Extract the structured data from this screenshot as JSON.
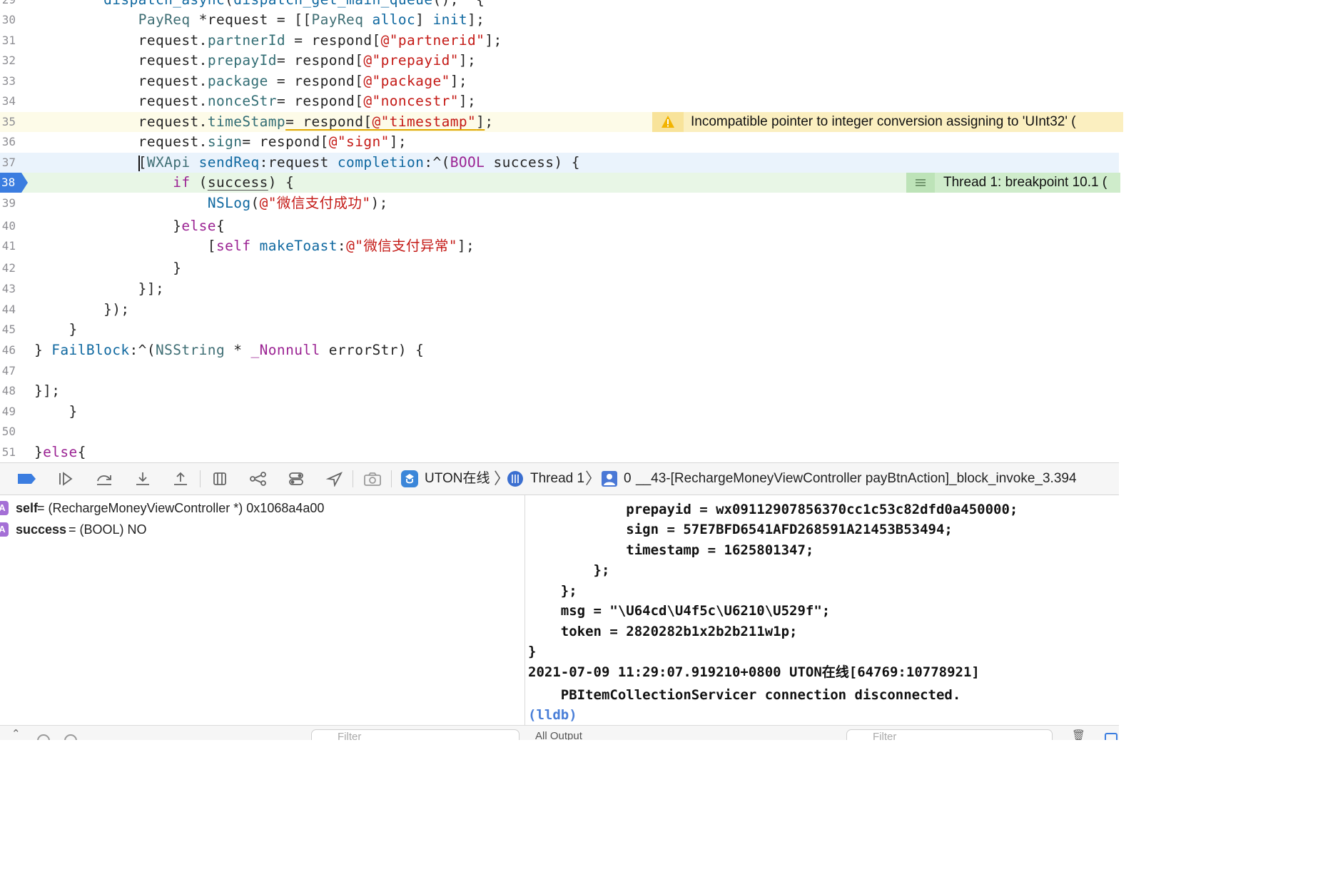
{
  "editor": {
    "lines": [
      {
        "num": "29",
        "html_tokens": [
          [
            "plain",
            "        "
          ],
          [
            "fn",
            "dispatch_async"
          ],
          [
            "plain",
            "("
          ],
          [
            "fn",
            "dispatch_get_main_queue"
          ],
          [
            "plain",
            "(), ^{"
          ]
        ]
      },
      {
        "num": "30",
        "tokens": [
          [
            "plain",
            "            "
          ],
          [
            "ty",
            "PayReq"
          ],
          [
            "plain",
            " *request = [["
          ],
          [
            "ty",
            "PayReq"
          ],
          [
            "plain",
            " "
          ],
          [
            "fn",
            "alloc"
          ],
          [
            "plain",
            "] "
          ],
          [
            "fn",
            "init"
          ],
          [
            "plain",
            "];"
          ]
        ]
      },
      {
        "num": "31",
        "tokens": [
          [
            "plain",
            "            request."
          ],
          [
            "prop",
            "partnerId"
          ],
          [
            "plain",
            " = respond["
          ],
          [
            "str",
            "@\"partnerid\""
          ],
          [
            "plain",
            "];"
          ]
        ]
      },
      {
        "num": "32",
        "tokens": [
          [
            "plain",
            "            request."
          ],
          [
            "prop",
            "prepayId"
          ],
          [
            "plain",
            "= respond["
          ],
          [
            "str",
            "@\"prepayid\""
          ],
          [
            "plain",
            "];"
          ]
        ]
      },
      {
        "num": "33",
        "tokens": [
          [
            "plain",
            "            request."
          ],
          [
            "prop",
            "package"
          ],
          [
            "plain",
            " = respond["
          ],
          [
            "str",
            "@\"package\""
          ],
          [
            "plain",
            "];"
          ]
        ]
      },
      {
        "num": "34",
        "tokens": [
          [
            "plain",
            "            request."
          ],
          [
            "prop",
            "nonceStr"
          ],
          [
            "plain",
            "= respond["
          ],
          [
            "str",
            "@\"noncestr\""
          ],
          [
            "plain",
            "];"
          ]
        ]
      },
      {
        "num": "35",
        "tokens": [
          [
            "plain",
            "            request."
          ],
          [
            "prop",
            "timeStamp"
          ],
          [
            "uline",
            "= respond["
          ],
          [
            "ustr",
            "@\"timestamp\""
          ],
          [
            "uline",
            "]"
          ],
          [
            "plain",
            ";"
          ]
        ]
      },
      {
        "num": "36",
        "tokens": [
          [
            "plain",
            "            request."
          ],
          [
            "prop",
            "sign"
          ],
          [
            "plain",
            "= respond["
          ],
          [
            "str",
            "@\"sign\""
          ],
          [
            "plain",
            "];"
          ]
        ]
      },
      {
        "num": "37",
        "tokens": [
          [
            "plain",
            "            "
          ],
          [
            "caret",
            ""
          ],
          [
            "plain",
            "["
          ],
          [
            "ty",
            "WXApi"
          ],
          [
            "plain",
            " "
          ],
          [
            "fn",
            "sendReq"
          ],
          [
            "plain",
            ":request "
          ],
          [
            "fn",
            "completion"
          ],
          [
            "plain",
            ":^("
          ],
          [
            "kw",
            "BOOL"
          ],
          [
            "plain",
            " success) {"
          ]
        ]
      },
      {
        "num": "38",
        "tokens": [
          [
            "plain",
            "                "
          ],
          [
            "kw",
            "if"
          ],
          [
            "plain",
            " ("
          ],
          [
            "ug",
            "success"
          ],
          [
            "plain",
            ") {"
          ]
        ]
      },
      {
        "num": "39",
        "tokens": [
          [
            "plain",
            "                    "
          ],
          [
            "fn",
            "NSLog"
          ],
          [
            "plain",
            "("
          ],
          [
            "str",
            "@\"微信支付成功\""
          ],
          [
            "plain",
            ");"
          ]
        ]
      },
      {
        "num": "40",
        "tokens": [
          [
            "plain",
            "                }"
          ],
          [
            "kw",
            "else"
          ],
          [
            "plain",
            "{"
          ]
        ]
      },
      {
        "num": "41",
        "tokens": [
          [
            "plain",
            "                    ["
          ],
          [
            "kw",
            "self"
          ],
          [
            "plain",
            " "
          ],
          [
            "fn",
            "makeToast"
          ],
          [
            "plain",
            ":"
          ],
          [
            "str",
            "@\"微信支付异常\""
          ],
          [
            "plain",
            "];"
          ]
        ]
      },
      {
        "num": "42",
        "tokens": [
          [
            "plain",
            "                }"
          ]
        ]
      },
      {
        "num": "43",
        "tokens": [
          [
            "plain",
            "            }];"
          ]
        ]
      },
      {
        "num": "44",
        "tokens": [
          [
            "plain",
            "        });"
          ]
        ]
      },
      {
        "num": "45",
        "tokens": [
          [
            "plain",
            "    }"
          ]
        ]
      },
      {
        "num": "46",
        "tokens": [
          [
            "plain",
            "} "
          ],
          [
            "fn",
            "FailBlock"
          ],
          [
            "plain",
            ":^("
          ],
          [
            "ty",
            "NSString"
          ],
          [
            "plain",
            " * "
          ],
          [
            "kw",
            "_Nonnull"
          ],
          [
            "plain",
            " errorStr) {"
          ]
        ]
      },
      {
        "num": "47",
        "tokens": [
          [
            "plain",
            ""
          ]
        ]
      },
      {
        "num": "48",
        "tokens": [
          [
            "plain",
            "}];"
          ]
        ]
      },
      {
        "num": "49",
        "tokens": [
          [
            "plain",
            "    }"
          ]
        ]
      },
      {
        "num": "50",
        "tokens": [
          [
            "plain",
            ""
          ]
        ]
      },
      {
        "num": "51",
        "tokens": [
          [
            "plain",
            "}"
          ],
          [
            "kw",
            "else"
          ],
          [
            "plain",
            "{"
          ]
        ]
      }
    ],
    "warning_text": "Incompatible pointer to integer conversion assigning to 'UInt32' (",
    "breakpoint_text": "Thread 1: breakpoint 10.1 (",
    "breakpoint_line": "38"
  },
  "debugbar": {
    "target": "UTON在线",
    "thread": "Thread 1",
    "frame_num": "0",
    "frame": "__43-[RechargeMoneyViewController payBtnAction]_block_invoke_3.394"
  },
  "variables": [
    {
      "badge": "A",
      "name": "self",
      "rest": " = (RechargeMoneyViewController *) 0x1068a4a00"
    },
    {
      "badge": "A",
      "name": "success",
      "rest": " = (BOOL) NO"
    }
  ],
  "console": {
    "lines": [
      "            prepayid = wx09112907856370cc1c53c82dfd0a450000;",
      "            sign = 57E7BFD6541AFD268591A21453B53494;",
      "            timestamp = 1625801347;",
      "        };",
      "    };",
      "    msg = \"\\U64cd\\U4f5c\\U6210\\U529f\";",
      "    token = 2820282b1x2b2b211w1p;",
      "}",
      "2021-07-09 11:29:07.919210+0800 UTON在线[64769:10778921]",
      "    PBItemCollectionServicer connection disconnected."
    ],
    "prompt": "(lldb)"
  },
  "filterbar": {
    "left_placeholder": "Filter",
    "output_selector": "All Output",
    "right_placeholder": "Filter"
  }
}
